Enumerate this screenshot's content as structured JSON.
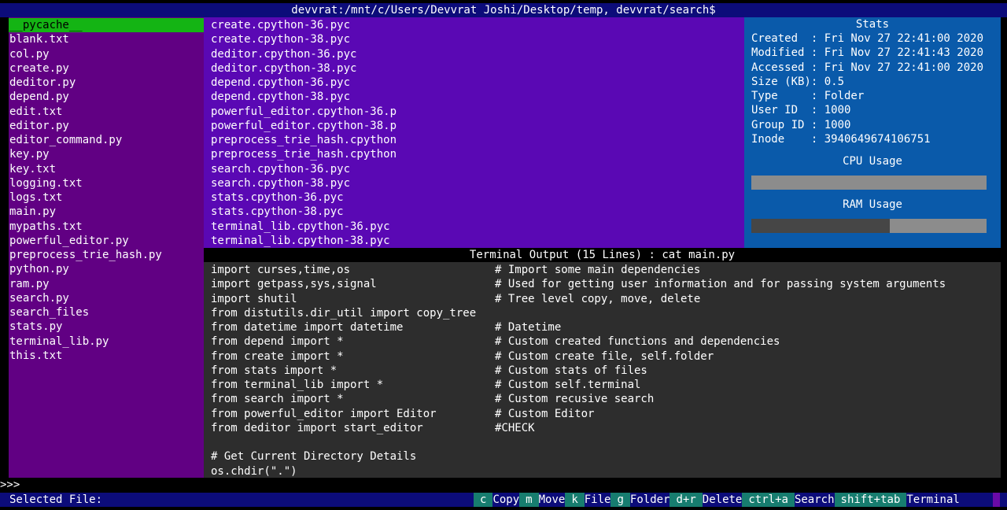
{
  "titlebar": "devvrat:/mnt/c/Users/Devvrat Joshi/Desktop/temp, devvrat/search$",
  "files": [
    "__pycache__",
    "blank.txt",
    "col.py",
    "create.py",
    "deditor.py",
    "depend.py",
    "edit.txt",
    "editor.py",
    "editor_command.py",
    "key.py",
    "key.txt",
    "logging.txt",
    "logs.txt",
    "main.py",
    "mypaths.txt",
    "powerful_editor.py",
    "preprocess_trie_hash.py",
    "python.py",
    "ram.py",
    "search.py",
    "search_files",
    "stats.py",
    "terminal_lib.py",
    "this.txt"
  ],
  "selected_index": 0,
  "subfiles": [
    "create.cpython-36.pyc",
    "create.cpython-38.pyc",
    "deditor.cpython-36.pyc",
    "deditor.cpython-38.pyc",
    "depend.cpython-36.pyc",
    "depend.cpython-38.pyc",
    "powerful_editor.cpython-36.p",
    "powerful_editor.cpython-38.p",
    "preprocess_trie_hash.cpython",
    "preprocess_trie_hash.cpython",
    "search.cpython-36.pyc",
    "search.cpython-38.pyc",
    "stats.cpython-36.pyc",
    "stats.cpython-38.pyc",
    "terminal_lib.cpython-36.pyc",
    "terminal_lib.cpython-38.pyc"
  ],
  "stats": {
    "title": "Stats",
    "rows": [
      "Created  : Fri Nov 27 22:41:00 2020",
      "Modified : Fri Nov 27 22:41:43 2020",
      "Accessed : Fri Nov 27 22:41:00 2020",
      "Size (KB): 0.5",
      "Type     : Folder",
      "User ID  : 1000",
      "Group ID : 1000",
      "Inode    : 3940649674106751"
    ],
    "cpu_label": "CPU Usage",
    "cpu_fraction": 0.0,
    "ram_label": "RAM Usage",
    "ram_fraction": 0.59
  },
  "terminal": {
    "header": "Terminal Output (15 Lines) : cat main.py",
    "lines": [
      {
        "code": "import curses,time,os",
        "comment": "# Import some main dependencies"
      },
      {
        "code": "import getpass,sys,signal",
        "comment": "# Used for getting user information and for passing system arguments"
      },
      {
        "code": "import shutil",
        "comment": "# Tree level copy, move, delete"
      },
      {
        "code": "from distutils.dir_util import copy_tree",
        "comment": ""
      },
      {
        "code": "from datetime import datetime",
        "comment": "# Datetime"
      },
      {
        "code": "from depend import *",
        "comment": "# Custom created functions and dependencies"
      },
      {
        "code": "from create import *",
        "comment": "# Custom create file, self.folder"
      },
      {
        "code": "from stats import *",
        "comment": "# Custom stats of files"
      },
      {
        "code": "from terminal_lib import *",
        "comment": "# Custom self.terminal"
      },
      {
        "code": "from search import *",
        "comment": "# Custom recusive search"
      },
      {
        "code": "from powerful_editor import Editor",
        "comment": "# Custom Editor"
      },
      {
        "code": "from deditor import start_editor",
        "comment": "#CHECK"
      },
      {
        "code": "",
        "comment": ""
      },
      {
        "code": "# Get Current Directory Details",
        "comment": ""
      },
      {
        "code": "os.chdir(\".\")",
        "comment": ""
      }
    ]
  },
  "prompt": ">>>",
  "status": {
    "label": "Selected File:",
    "shortcuts": [
      {
        "key": "c",
        "action": "Copy"
      },
      {
        "key": "m",
        "action": "Move"
      },
      {
        "key": "k",
        "action": "File"
      },
      {
        "key": "g",
        "action": "Folder"
      },
      {
        "key": "d+r",
        "action": "Delete"
      },
      {
        "key": "ctrl+a",
        "action": "Search"
      },
      {
        "key": "shift+tab",
        "action": "Terminal"
      }
    ]
  }
}
